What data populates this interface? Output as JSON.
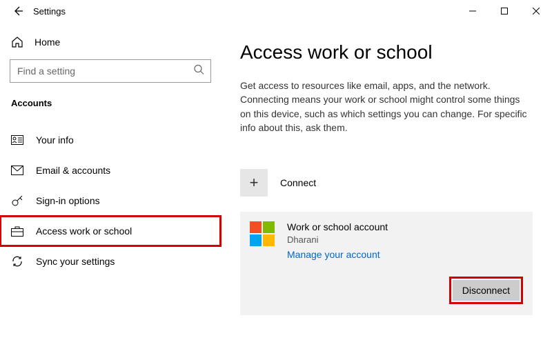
{
  "titlebar": {
    "label": "Settings"
  },
  "sidebar": {
    "home": "Home",
    "search_placeholder": "Find a setting",
    "section": "Accounts",
    "items": [
      {
        "label": "Your info"
      },
      {
        "label": "Email & accounts"
      },
      {
        "label": "Sign-in options"
      },
      {
        "label": "Access work or school"
      },
      {
        "label": "Sync your settings"
      }
    ]
  },
  "main": {
    "title": "Access work or school",
    "description": "Get access to resources like email, apps, and the network. Connecting means your work or school might control some things on this device, such as which settings you can change. For specific info about this, ask them.",
    "connect_label": "Connect",
    "account": {
      "title": "Work or school account",
      "user": "Dharani",
      "manage": "Manage your account",
      "disconnect": "Disconnect"
    }
  }
}
